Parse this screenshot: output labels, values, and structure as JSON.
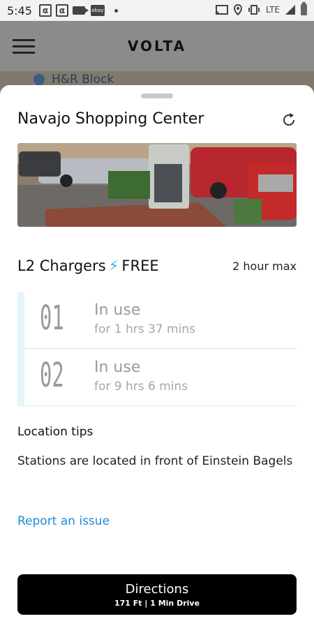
{
  "status_bar": {
    "time": "5:45",
    "alpha1": "α",
    "alpha2": "α",
    "ebay": "ebay",
    "network": "LTE"
  },
  "app_bar": {
    "brand": "VOLTA"
  },
  "map": {
    "place_label": "H&R Block"
  },
  "sheet": {
    "title": "Navajo Shopping Center",
    "chargers": {
      "type_label": "L2 Chargers",
      "price_label": "FREE",
      "limit_label": "2 hour max",
      "items": [
        {
          "number": "01",
          "status": "In use",
          "duration": "for 1 hrs 37 mins"
        },
        {
          "number": "02",
          "status": "In use",
          "duration": "for 9 hrs 6 mins"
        }
      ]
    },
    "tips": {
      "title": "Location tips",
      "text": "Stations are located in front of Einstein Bagels"
    },
    "report_link": "Report an issue",
    "directions": {
      "label": "Directions",
      "sub": "171 Ft | 1 Min Drive"
    }
  },
  "colors": {
    "accent_blue": "#1f8ad6",
    "bolt": "#31b6ef",
    "button_bg": "#000000"
  }
}
